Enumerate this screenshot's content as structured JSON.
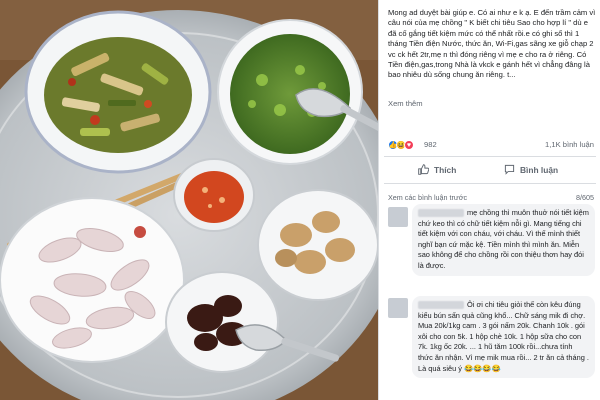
{
  "post": {
    "body": "Mong ad duyệt bài giúp e. Có ai như e k ạ. E đến trầm cảm vì câu nói của mẹ chồng \" K biết chi tiêu Sao cho hợp lí \" dù e đã cố gắng tiết kiệm mức có thể nhất rồi.e có ghi sổ thì 1 tháng Tiền điện Nước, thức ăn, Wi-Fi,gas sãng xe giỗ chạp 2 vc ck hết 2tr,mẹ n thì đóng riêng vì mẹ e cho ra ở riêng. Có Tiền điện,gas,trong Nhà là vkck e gánh hết vì chẳng đâng là bao nhiêu dù sống chung ăn riêng. t...",
    "see_more": "Xem thêm",
    "reaction_count": "982",
    "comment_count": "1,1K bình luận"
  },
  "actions": {
    "like": "Thích",
    "comment": "Bình luận"
  },
  "comments_header": {
    "view_previous": "Xem các bình luận trước",
    "counter": "8/605"
  },
  "comments": [
    {
      "text": "mẹ chồng thì muôn thuở nói tiết kiệm chứ keo thì có chữ tiết kiệm nỗi gì. Mang tiếng chi tiết kiệm với con cháu, với cháu. Vì thế mình thiết nghĩ bạn cứ mặc kệ. Tiền mình thì mình ăn. Miễn sao không để cho chồng rồi con thiệu thơn hay đói là được."
    },
    {
      "text": "Ôi ơi chi tiêu giỏi thế còn kêu đúng kiểu bún sấn quả cũng khổ... Chữ sáng mik đi chợ. Mua 20k/1kg cam . 3 gói nấm 20k. Chanh 10k . gói xôi cho con 5k. 1 hộp chè 10k. 1 hộp sữa cho con 7k. 1kg ốc 20k. ... 1 hũ tăm 100k rồi...chưa tính thức ăn nhận. Vì mẹ mik mua rồi... 2 tr ăn cả tháng . Là quá siêu ý 😂😂😂😂"
    }
  ],
  "colors": {
    "like_blue": "#1877f2",
    "love_red": "#f33e58",
    "haha_yellow": "#f7b125",
    "text_primary": "#1c1e21",
    "text_secondary": "#606770",
    "bubble_gray": "#f2f3f5",
    "divider": "#dadde1"
  }
}
